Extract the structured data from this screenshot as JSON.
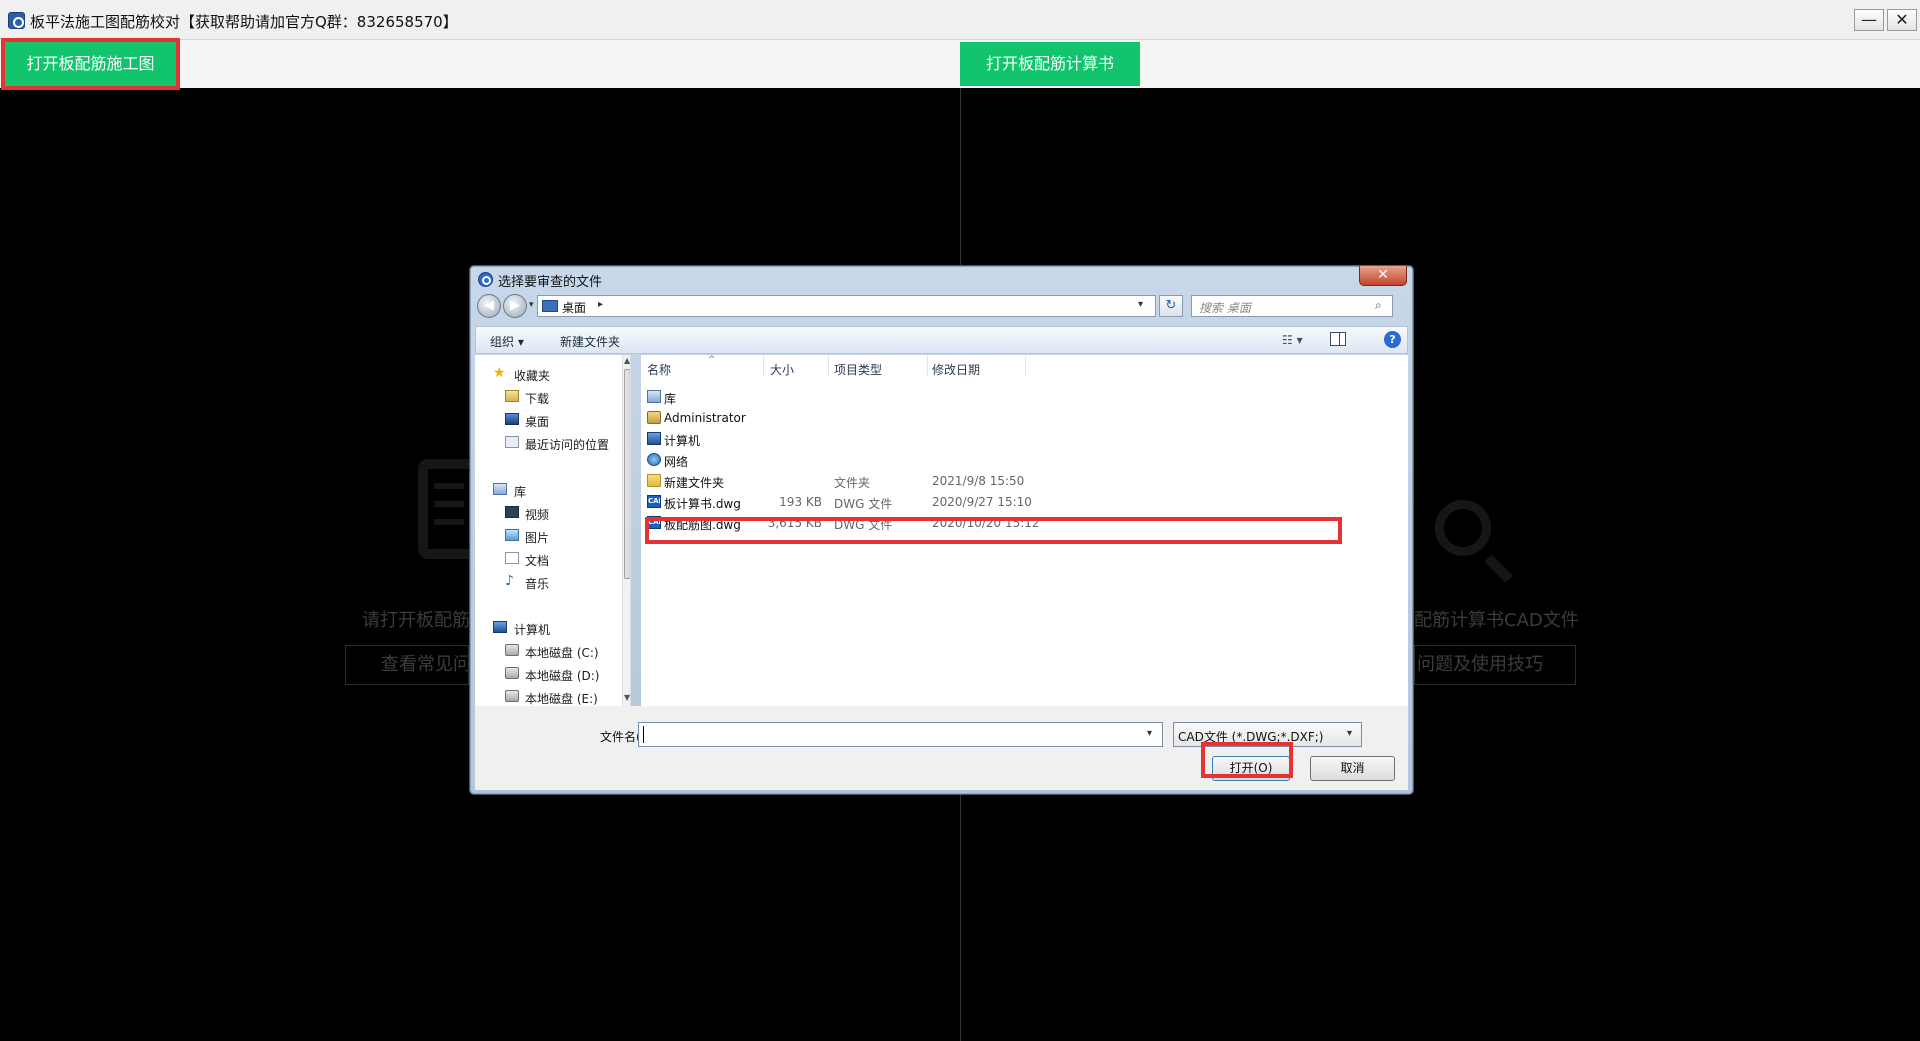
{
  "window": {
    "title": "板平法施工图配筋校对【获取帮助请加官方Q群：832658570】",
    "minimize_label": "—",
    "close_label": "✕"
  },
  "toolbar": {
    "open_drawing_label": "打开板配筋施工图",
    "open_calc_label": "打开板配筋计算书"
  },
  "background": {
    "left_prompt": "请打开板配筋",
    "left_button": "查看常见问",
    "right_prompt": "配筋计算书CAD文件",
    "right_button": "问题及使用技巧"
  },
  "dialog": {
    "title": "选择要审查的文件",
    "close_label": "✕",
    "nav": {
      "back": "◀",
      "forward": "▶",
      "dropdown": "▾",
      "address": "桌面",
      "address_arrow": "▸",
      "address_dropdown": "▾",
      "refresh": "↻",
      "search_placeholder": "搜索 桌面",
      "search_icon": "⌕"
    },
    "commands": {
      "organize": "组织 ▾",
      "new_folder": "新建文件夹",
      "view_toggle": "☷ ▾",
      "help": "?"
    },
    "nav_pane": {
      "items": [
        {
          "label": "收藏夹",
          "icon": "star-icon"
        },
        {
          "label": "下载",
          "icon": "downloads-icon"
        },
        {
          "label": "桌面",
          "icon": "desktop-icon"
        },
        {
          "label": "最近访问的位置",
          "icon": "recent-places-icon"
        },
        {
          "label": "库",
          "icon": "library-icon"
        },
        {
          "label": "视频",
          "icon": "video-icon"
        },
        {
          "label": "图片",
          "icon": "pictures-icon"
        },
        {
          "label": "文档",
          "icon": "documents-icon"
        },
        {
          "label": "音乐",
          "icon": "music-icon"
        },
        {
          "label": "计算机",
          "icon": "computer-icon"
        },
        {
          "label": "本地磁盘 (C:)",
          "icon": "disk-icon"
        },
        {
          "label": "本地磁盘 (D:)",
          "icon": "disk-icon"
        },
        {
          "label": "本地磁盘 (E:)",
          "icon": "disk-icon"
        }
      ],
      "scroll_up": "▲",
      "scroll_down": "▼"
    },
    "columns": {
      "name": "名称",
      "size": "大小",
      "type": "项目类型",
      "modified": "修改日期",
      "sort_caret": "^"
    },
    "files": [
      {
        "name": "库",
        "size": "",
        "type": "",
        "modified": "",
        "icon": "library-icon"
      },
      {
        "name": "Administrator",
        "size": "",
        "type": "",
        "modified": "",
        "icon": "user-folder-icon"
      },
      {
        "name": "计算机",
        "size": "",
        "type": "",
        "modified": "",
        "icon": "computer-icon"
      },
      {
        "name": "网络",
        "size": "",
        "type": "",
        "modified": "",
        "icon": "network-icon"
      },
      {
        "name": "新建文件夹",
        "size": "",
        "type": "文件夹",
        "modified": "2021/9/8 15:50",
        "icon": "folder-icon"
      },
      {
        "name": "板计算书.dwg",
        "size": "193 KB",
        "type": "DWG 文件",
        "modified": "2020/9/27 15:10",
        "icon": "cad-file-icon"
      },
      {
        "name": "板配筋图.dwg",
        "size": "3,615 KB",
        "type": "DWG 文件",
        "modified": "2020/10/20 15:12",
        "icon": "cad-file-icon"
      }
    ],
    "cad_icon_text": "CAD",
    "filename_label": "文件名(N):",
    "filename_value": "",
    "filename_dropdown": "▾",
    "filter_value": "CAD文件 (*.DWG;*.DXF;)",
    "filter_dropdown": "▾",
    "open_button": "打开(O)",
    "cancel_button": "取消"
  },
  "colors": {
    "accent_green": "#12c46c",
    "highlight_red": "#e53333"
  }
}
